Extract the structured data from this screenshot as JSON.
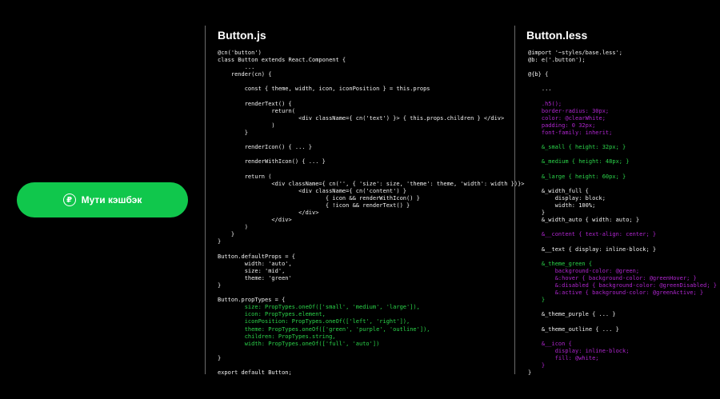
{
  "button": {
    "label": "Мути кэшбэк",
    "icon": "ruble-icon",
    "icon_glyph": "₽",
    "color": "#10c74c"
  },
  "js_panel": {
    "title": "Button.js",
    "lines": [
      {
        "t": "@cn('button')",
        "c": "default"
      },
      {
        "t": "class Button extends React.Component {",
        "c": "default"
      },
      {
        "t": "        ...",
        "c": "default"
      },
      {
        "t": "    render(cn) {",
        "c": "default"
      },
      {
        "t": "",
        "c": "default"
      },
      {
        "t": "        const { theme, width, icon, iconPosition } = this.props",
        "c": "default"
      },
      {
        "t": "",
        "c": "default"
      },
      {
        "t": "        renderText() {",
        "c": "default"
      },
      {
        "t": "                return(",
        "c": "default"
      },
      {
        "t": "                        <div className={ cn('text') }> { this.props.children } </div>",
        "c": "default"
      },
      {
        "t": "                )",
        "c": "default"
      },
      {
        "t": "        }",
        "c": "default"
      },
      {
        "t": "",
        "c": "default"
      },
      {
        "t": "        renderIcon() { ... }",
        "c": "default"
      },
      {
        "t": "",
        "c": "default"
      },
      {
        "t": "        renderWithIcon() { ... }",
        "c": "default"
      },
      {
        "t": "",
        "c": "default"
      },
      {
        "t": "        return (",
        "c": "default"
      },
      {
        "t": "                <div className={ cn('', { 'size': size, 'theme': theme, 'width': width })}>",
        "c": "default"
      },
      {
        "t": "                        <div className={ cn('content') }",
        "c": "default"
      },
      {
        "t": "                                { icon && renderWithIcon() }",
        "c": "default"
      },
      {
        "t": "                                { !icon && renderText() }",
        "c": "default"
      },
      {
        "t": "                        </div>",
        "c": "default"
      },
      {
        "t": "                </div>",
        "c": "default"
      },
      {
        "t": "        )",
        "c": "default"
      },
      {
        "t": "    }",
        "c": "default"
      },
      {
        "t": "}",
        "c": "default"
      },
      {
        "t": "",
        "c": "default"
      },
      {
        "t": "Button.defaultProps = {",
        "c": "default"
      },
      {
        "t": "        width: 'auto',",
        "c": "default"
      },
      {
        "t": "        size: 'mid',",
        "c": "default"
      },
      {
        "t": "        theme: 'green'",
        "c": "default"
      },
      {
        "t": "}",
        "c": "default"
      },
      {
        "t": "",
        "c": "default"
      },
      {
        "t": "Button.propTypes = {",
        "c": "default"
      },
      {
        "t": "        size: PropTypes.oneOf(['small', 'medium', 'large']),",
        "c": "green"
      },
      {
        "t": "        icon: PropTypes.element,",
        "c": "green"
      },
      {
        "t": "        iconPosition: PropTypes.oneOf(['left', 'right']),",
        "c": "green"
      },
      {
        "t": "        theme: PropTypes.oneOf(['green', 'purple', 'outline']),",
        "c": "green"
      },
      {
        "t": "        children: PropTypes.string,",
        "c": "green"
      },
      {
        "t": "        width: PropTypes.oneOf(['full', 'auto'])",
        "c": "green"
      },
      {
        "t": "",
        "c": "default"
      },
      {
        "t": "}",
        "c": "default"
      },
      {
        "t": "",
        "c": "default"
      },
      {
        "t": "export default Button;",
        "c": "default"
      }
    ]
  },
  "less_panel": {
    "title": "Button.less",
    "lines": [
      {
        "t": "@import '~styles/base.less';",
        "c": "default"
      },
      {
        "t": "@b: e('.button');",
        "c": "default"
      },
      {
        "t": "",
        "c": "default"
      },
      {
        "t": "@{b} {",
        "c": "default"
      },
      {
        "t": "",
        "c": "default"
      },
      {
        "t": "    ...",
        "c": "default"
      },
      {
        "t": "",
        "c": "default"
      },
      {
        "t": "    .h5();",
        "c": "purple"
      },
      {
        "t": "    border-radius: 30px;",
        "c": "purple"
      },
      {
        "t": "    color: @clearWhite;",
        "c": "purple"
      },
      {
        "t": "    padding: 0 32px;",
        "c": "purple"
      },
      {
        "t": "    font-family: inherit;",
        "c": "purple"
      },
      {
        "t": "",
        "c": "default"
      },
      {
        "t": "    &_small { height: 32px; }",
        "c": "green"
      },
      {
        "t": "",
        "c": "default"
      },
      {
        "t": "    &_medium { height: 48px; }",
        "c": "green"
      },
      {
        "t": "",
        "c": "default"
      },
      {
        "t": "    &_large { height: 60px; }",
        "c": "green"
      },
      {
        "t": "",
        "c": "default"
      },
      {
        "t": "    &_width_full {",
        "c": "default"
      },
      {
        "t": "        display: block;",
        "c": "default"
      },
      {
        "t": "        width: 100%;",
        "c": "default"
      },
      {
        "t": "    }",
        "c": "default"
      },
      {
        "t": "    &_width_auto { width: auto; }",
        "c": "default"
      },
      {
        "t": "",
        "c": "default"
      },
      {
        "t": "    &__content { text-align: center; }",
        "c": "purple"
      },
      {
        "t": "",
        "c": "default"
      },
      {
        "t": "    &__text { display: inline-block; }",
        "c": "default"
      },
      {
        "t": "",
        "c": "default"
      },
      {
        "t": "    &_theme_green {",
        "c": "green"
      },
      {
        "t": "        background-color: @green;",
        "c": "purple"
      },
      {
        "t": "        &:hover { background-color: @greenHover; }",
        "c": "purple"
      },
      {
        "t": "        &:disabled { background-color: @greenDisabled; }",
        "c": "purple"
      },
      {
        "t": "        &:active { background-color: @greenActive; }",
        "c": "purple"
      },
      {
        "t": "    }",
        "c": "green"
      },
      {
        "t": "",
        "c": "default"
      },
      {
        "t": "    &_theme_purple { ... }",
        "c": "default"
      },
      {
        "t": "",
        "c": "default"
      },
      {
        "t": "    &_theme_outline { ... }",
        "c": "default"
      },
      {
        "t": "",
        "c": "default"
      },
      {
        "t": "    &__icon {",
        "c": "purple"
      },
      {
        "t": "        display: inline-block;",
        "c": "purple"
      },
      {
        "t": "        fill: @white;",
        "c": "purple"
      },
      {
        "t": "    }",
        "c": "purple"
      },
      {
        "t": "}",
        "c": "default"
      }
    ]
  }
}
